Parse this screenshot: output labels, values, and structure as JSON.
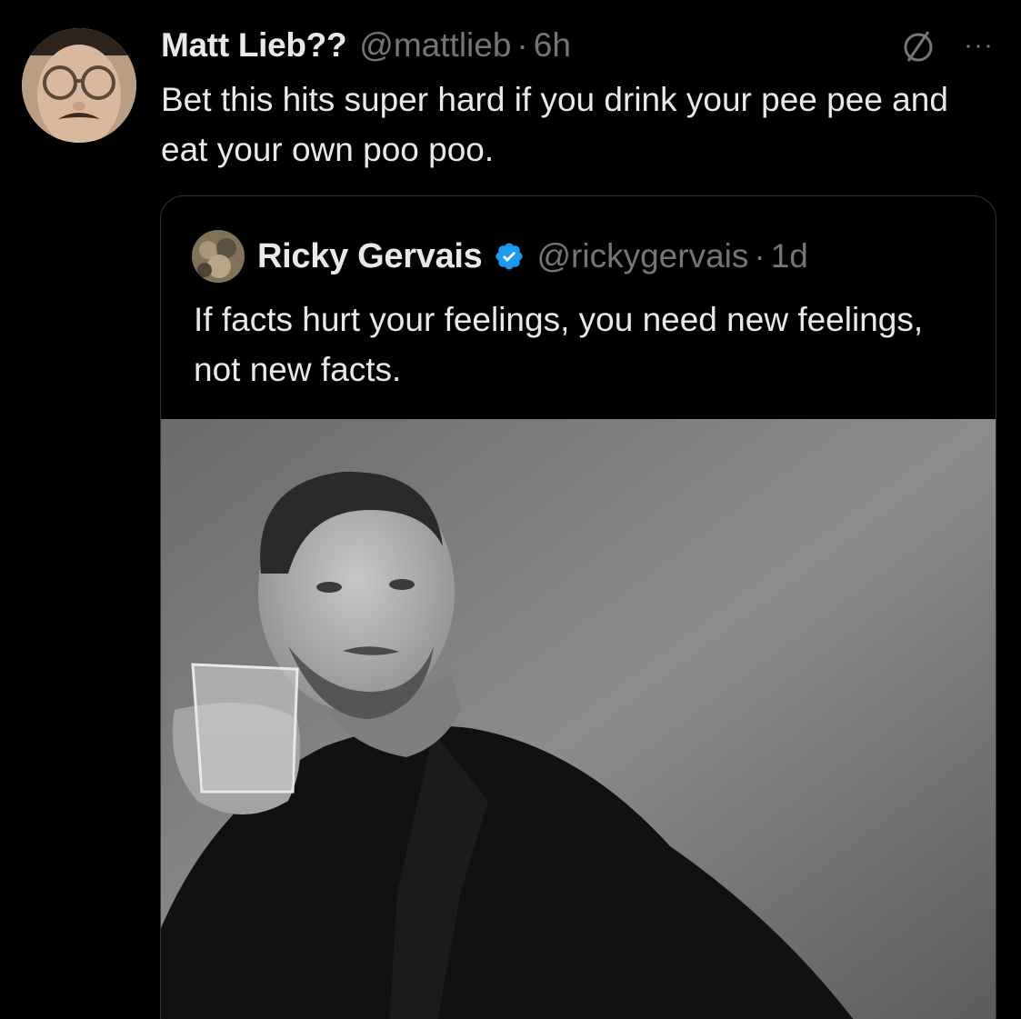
{
  "tweet": {
    "display_name": "Matt Lieb??",
    "handle": "@mattlieb",
    "separator": "·",
    "time": "6h",
    "text": "Bet this hits super hard if you drink your pee pee and eat your own poo poo.",
    "avatar_icon": "user-avatar",
    "header_icons": [
      "no-entry-icon",
      "more-icon"
    ],
    "more_glyph": "···"
  },
  "quoted_tweet": {
    "display_name": "Ricky Gervais",
    "verified": true,
    "handle": "@rickygervais",
    "separator": "·",
    "time": "1d",
    "text": "If facts hurt your feelings, you need new feelings, not new facts.",
    "media": "black-and-white portrait photo"
  },
  "colors": {
    "background": "#000000",
    "primary_text": "#e7e9ea",
    "secondary_text": "#71767b",
    "border": "#2f3336",
    "verified_badge": "#1d9bf0"
  }
}
